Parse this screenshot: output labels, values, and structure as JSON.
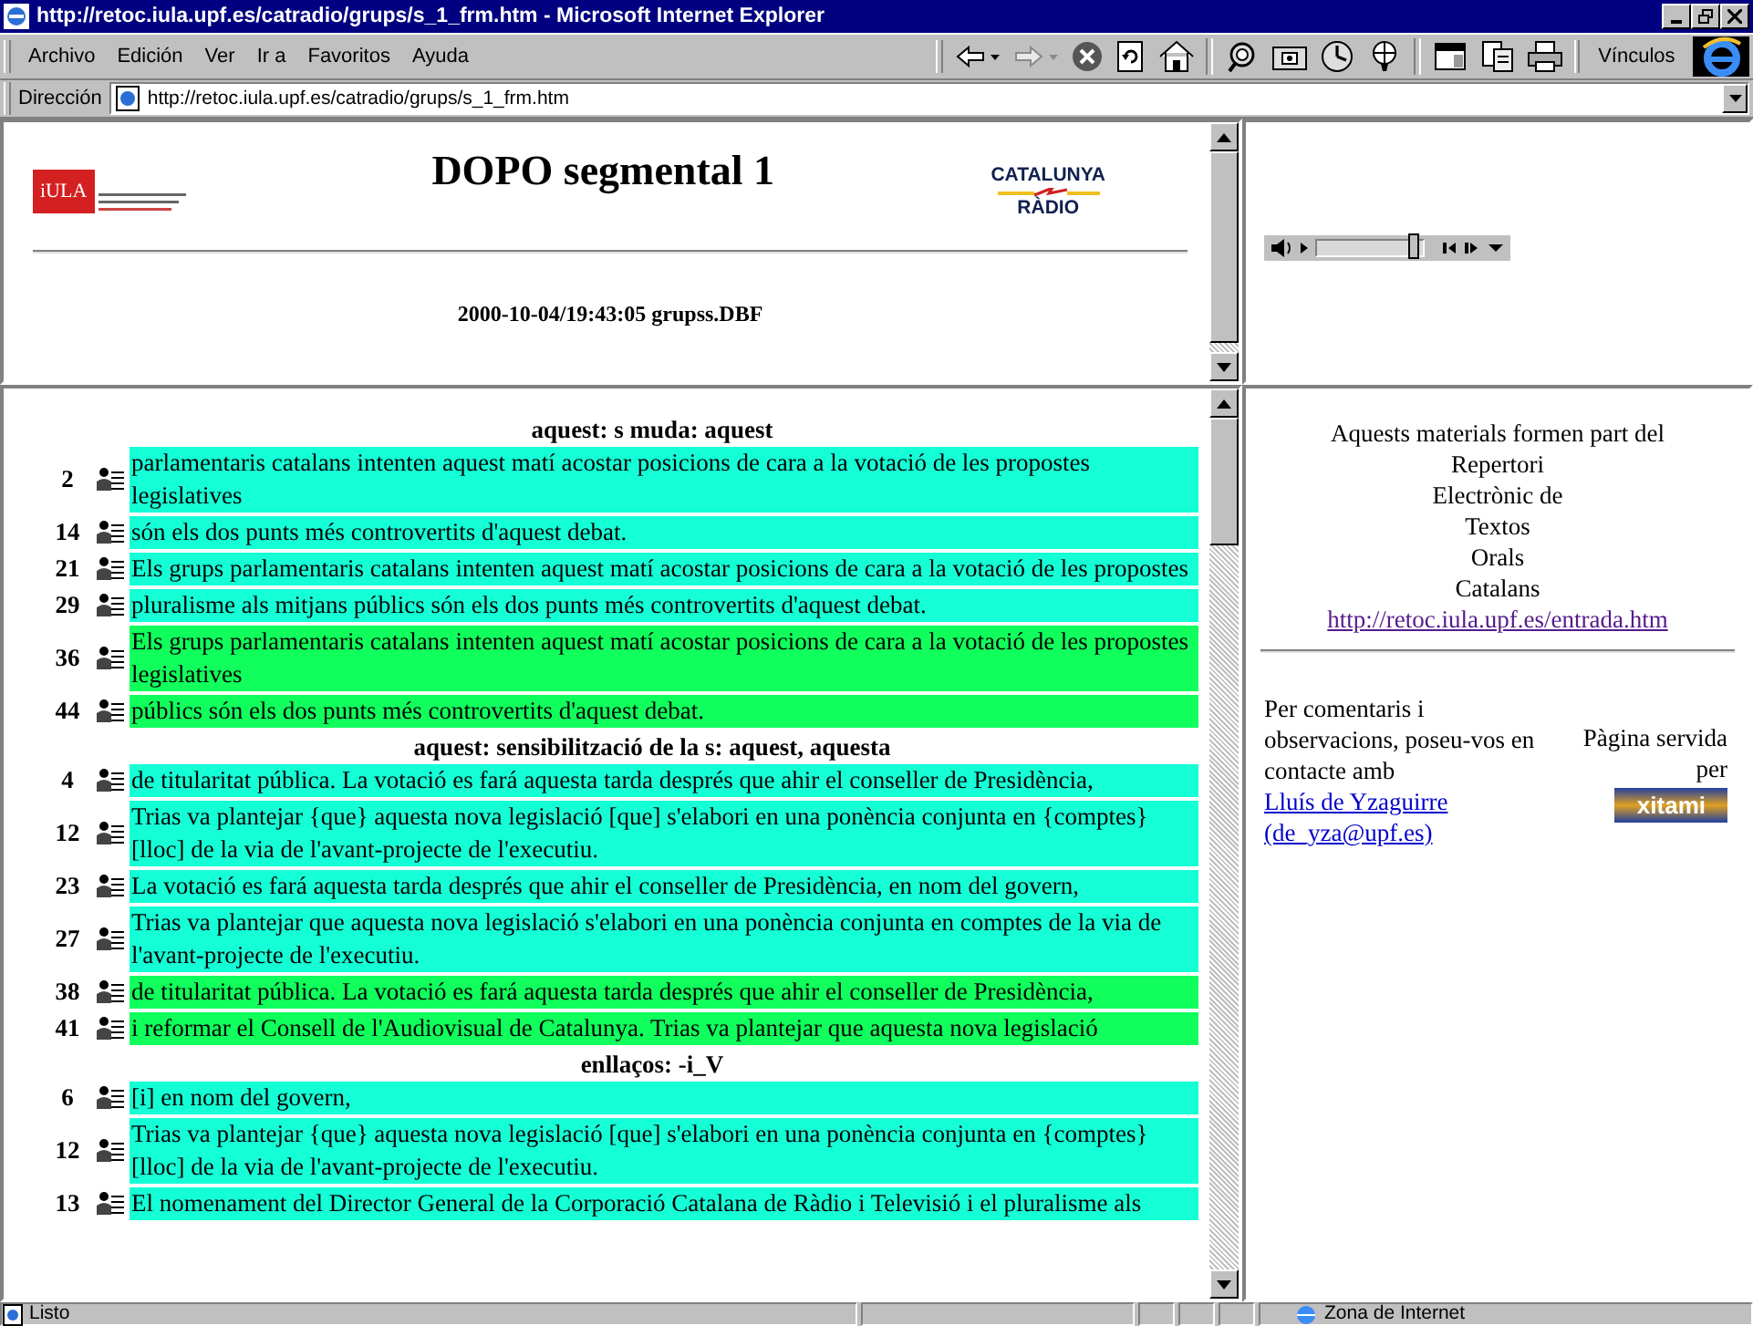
{
  "window": {
    "title": "http://retoc.iula.upf.es/catradio/grups/s_1_frm.htm - Microsoft Internet Explorer"
  },
  "menu": [
    {
      "label": "Archivo"
    },
    {
      "label": "Edición"
    },
    {
      "label": "Ver"
    },
    {
      "label": "Ir a"
    },
    {
      "label": "Favoritos"
    },
    {
      "label": "Ayuda"
    }
  ],
  "links_label": "Vínculos",
  "address": {
    "label": "Dirección",
    "value": "http://retoc.iula.upf.es/catradio/grups/s_1_frm.htm"
  },
  "header_frame": {
    "logo_left": "iULA",
    "title": "DOPO segmental 1",
    "logo_right_top": "CATALUNYA",
    "logo_right_bottom": "RÀDIO",
    "timestamp": "2000-10-04/19:43:05 grupss.DBF"
  },
  "player": {
    "level": 0.92
  },
  "sections": [
    {
      "heading": "aquest: s muda: aquest",
      "rows": [
        {
          "number": "2",
          "text": "parlamentaris catalans intenten aquest matí acostar posicions de cara a la votació de les propostes legislatives",
          "color": "#14ffd6"
        },
        {
          "number": "14",
          "text": "són els dos punts més controvertits d'aquest debat.",
          "color": "#14ffd6"
        },
        {
          "number": "21",
          "text": "Els grups parlamentaris catalans intenten aquest matí acostar posicions de cara a la votació de les propostes",
          "color": "#14ffd6"
        },
        {
          "number": "29",
          "text": "pluralisme als mitjans públics són els dos punts més controvertits d'aquest debat.",
          "color": "#14ffd6"
        },
        {
          "number": "36",
          "text": "Els grups parlamentaris catalans intenten aquest matí acostar posicions de cara a la votació de les propostes legislatives",
          "color": "#10ff5c"
        },
        {
          "number": "44",
          "text": "públics són els dos punts més controvertits d'aquest debat.",
          "color": "#10ff5c"
        }
      ]
    },
    {
      "heading": "aquest: sensibilització de la s: aquest, aquesta",
      "rows": [
        {
          "number": "4",
          "text": "de titularitat pública. La votació es fará aquesta tarda després que ahir el conseller de Presidència,",
          "color": "#14ffd6"
        },
        {
          "number": "12",
          "text": "Trias va plantejar {que}  aquesta nova legislació [que] s'elabori en una ponència conjunta en {comptes} [lloc] de la via de l'avant-projecte de l'executiu.",
          "color": "#14ffd6"
        },
        {
          "number": "23",
          "text": "La votació es fará aquesta tarda després que ahir el conseller de Presidència, en nom del govern,",
          "color": "#14ffd6"
        },
        {
          "number": "27",
          "text": "Trias va plantejar que aquesta nova legislació s'elabori en una ponència conjunta en comptes de la via de l'avant-projecte de l'executiu.",
          "color": "#14ffd6"
        },
        {
          "number": "38",
          "text": "de titularitat pública. La votació es fará aquesta tarda després que ahir el conseller de Presidència,",
          "color": "#10ff5c"
        },
        {
          "number": "41",
          "text": "i reformar el Consell de l'Audiovisual de Catalunya. Trias va plantejar que aquesta nova legislació",
          "color": "#10ff5c"
        }
      ]
    },
    {
      "heading": "enllaços: -i_V",
      "rows": [
        {
          "number": "6",
          "text": "[i] en nom del govern,",
          "color": "#14ffd6"
        },
        {
          "number": "12",
          "text": "Trias va plantejar {que}  aquesta nova legislació [que] s'elabori en una ponència conjunta en {comptes} [lloc] de la via de l'avant-projecte de l'executiu.",
          "color": "#14ffd6"
        },
        {
          "number": "13",
          "text": "El nomenament del Director General de la Corporació Catalana de Ràdio i Televisió i el pluralisme als",
          "color": "#14ffd6"
        }
      ]
    }
  ],
  "info_panel": {
    "lines": [
      "Aquests materials formen part del",
      "Repertori",
      "Electrònic de",
      "Textos",
      "Orals",
      "Catalans"
    ],
    "link": "http://retoc.iula.upf.es/entrada.htm",
    "contact_text": "Per comentaris i observacions, poseu-vos en contacte amb",
    "contact_name": "Lluís de Yzaguirre",
    "contact_email": "(de_yza@upf.es)",
    "served_by": "Pàgina servida per",
    "server_logo": "xitami"
  },
  "status_bar": {
    "text": "Listo",
    "zone": "Zona de Internet"
  }
}
